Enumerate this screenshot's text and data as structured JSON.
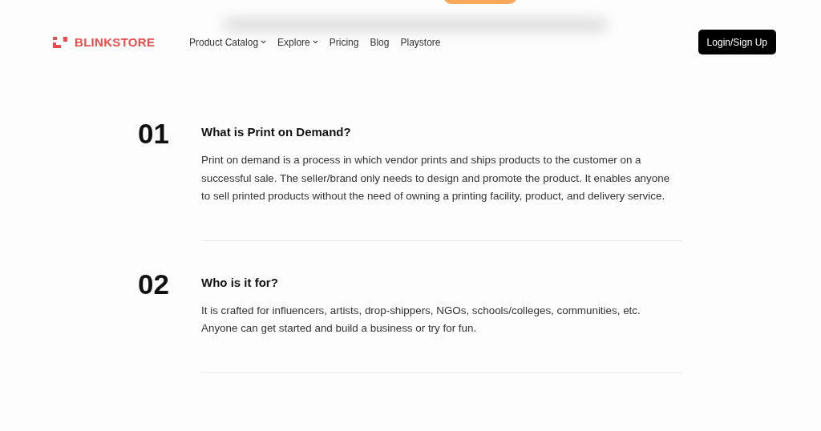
{
  "header": {
    "brand": "BLINKSTORE",
    "nav": [
      {
        "label": "Product Catalog",
        "dropdown": true
      },
      {
        "label": "Explore",
        "dropdown": true
      },
      {
        "label": "Pricing",
        "dropdown": false
      },
      {
        "label": "Blog",
        "dropdown": false
      },
      {
        "label": "Playstore",
        "dropdown": false
      }
    ],
    "login_button": "Login/Sign Up"
  },
  "faq": [
    {
      "number": "01",
      "question": "What is Print on Demand?",
      "answer": "Print on demand is a process in which vendor prints and ships products to the customer on a successful sale. The seller/brand only needs to design and promote the product. It enables anyone to sell printed products without the need of owning a printing facility, product, and delivery service."
    },
    {
      "number": "02",
      "question": "Who is it for?",
      "answer": "It is crafted for influencers, artists, drop-shippers, NGOs, schools/colleges, communities, etc. Anyone can get started and build a business or try for fun."
    }
  ]
}
